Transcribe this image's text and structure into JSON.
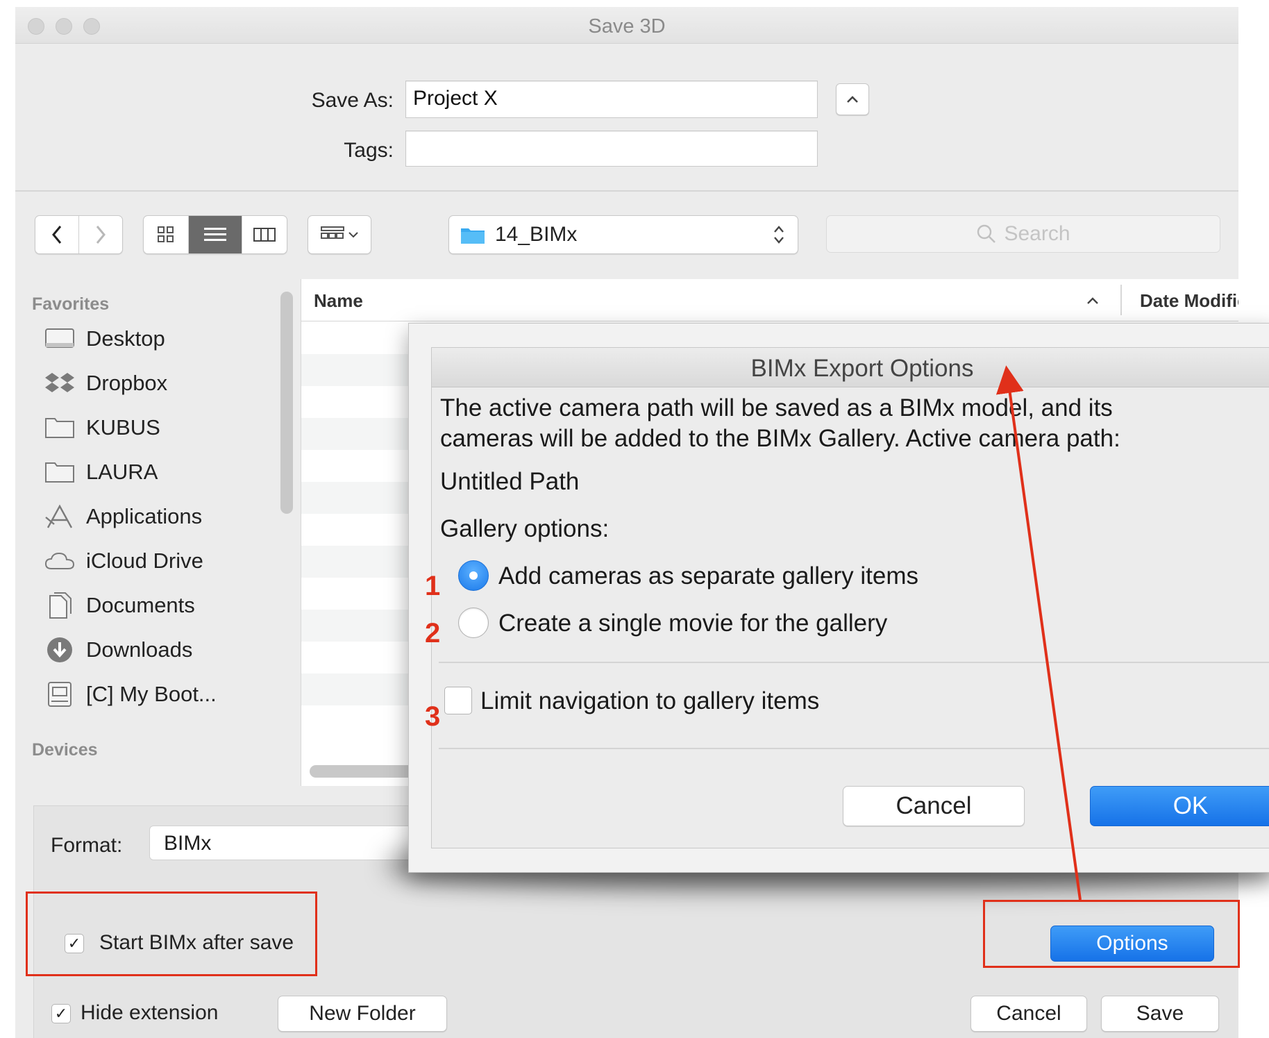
{
  "window": {
    "title": "Save 3D"
  },
  "save_form": {
    "save_as_label": "Save As:",
    "save_as_value": "Project X",
    "tags_label": "Tags:",
    "tags_value": ""
  },
  "toolbar": {
    "folder_name": "14_BIMx",
    "search_placeholder": "Search"
  },
  "sidebar": {
    "favorites_header": "Favorites",
    "items": [
      {
        "label": "Desktop",
        "icon": "desktop-icon"
      },
      {
        "label": "Dropbox",
        "icon": "dropbox-icon"
      },
      {
        "label": "KUBUS",
        "icon": "folder-icon"
      },
      {
        "label": "LAURA",
        "icon": "folder-icon"
      },
      {
        "label": "Applications",
        "icon": "applications-icon"
      },
      {
        "label": "iCloud Drive",
        "icon": "cloud-icon"
      },
      {
        "label": "Documents",
        "icon": "documents-icon"
      },
      {
        "label": "Downloads",
        "icon": "downloads-icon"
      },
      {
        "label": "[C] My Boot...",
        "icon": "drive-icon"
      }
    ],
    "devices_header": "Devices"
  },
  "file_list": {
    "columns": [
      "Name",
      "Date Modifie"
    ]
  },
  "format": {
    "label": "Format:",
    "value": "BIMx"
  },
  "start_after_save": {
    "label": "Start BIMx after save",
    "checked": true
  },
  "options_button": "Options",
  "bottom_bar": {
    "hide_extension_label": "Hide extension",
    "hide_extension_checked": true,
    "new_folder": "New Folder",
    "cancel": "Cancel",
    "save": "Save"
  },
  "bimx_dialog": {
    "title": "BIMx Export Options",
    "description_line1": "The active camera path will be saved as a BIMx model, and its",
    "description_line2": "cameras will be added to the BIMx Gallery. Active camera path:",
    "camera_path": "Untitled Path",
    "gallery_options_label": "Gallery options:",
    "option1": "Add cameras as separate gallery items",
    "option2": "Create a single movie for the gallery",
    "selected_option": 1,
    "limit_navigation": "Limit navigation to gallery items",
    "limit_navigation_checked": false,
    "cancel": "Cancel",
    "ok": "OK"
  },
  "annotations": {
    "num1": "1",
    "num2": "2",
    "num3": "3",
    "accent_color": "#e0301a"
  }
}
